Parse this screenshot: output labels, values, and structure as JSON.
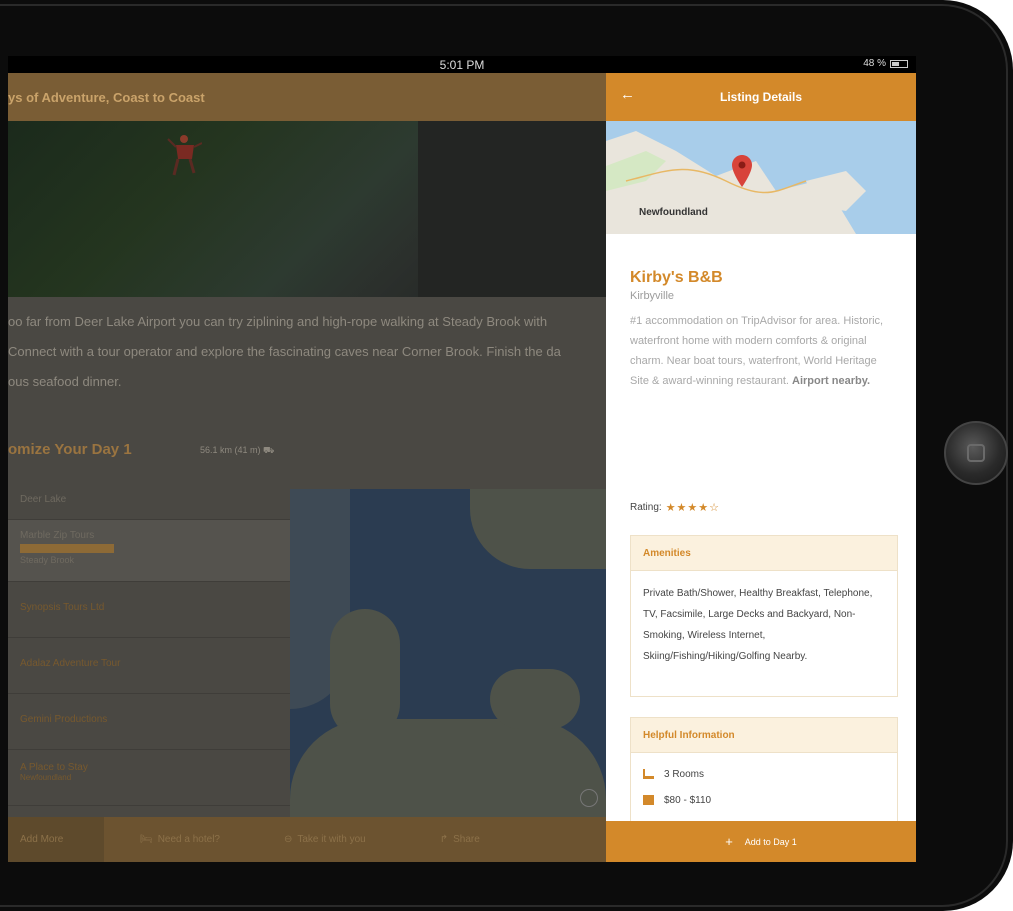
{
  "status_bar": {
    "time": "5:01 PM",
    "battery": "48 %"
  },
  "trip": {
    "title": "ys of Adventure, Coast to Coast",
    "intro_lines": [
      "oo far from Deer Lake Airport you can try ziplining and high-rope walking at Steady Brook with",
      "Connect with a tour operator and explore the fascinating caves near Corner Brook. Finish the da",
      "ous seafood dinner."
    ],
    "customize_title": "omize Your Day 1",
    "distance": "56.1 km (41 m)",
    "list": [
      {
        "label": "Deer Lake"
      },
      {
        "label": "Marble Zip Tours",
        "sub": "Steady Brook"
      },
      {
        "label": "Synopsis Tours Ltd"
      },
      {
        "label": "Adalaz Adventure Tour"
      },
      {
        "label": "Gemini Productions"
      },
      {
        "label": "A Place to Stay",
        "sub": "Newfoundland"
      }
    ],
    "bottom_bar": {
      "add_more": "Add More",
      "need_hotel": "Need a hotel?",
      "take_with_you": "Take it with you",
      "share": "Share"
    }
  },
  "panel": {
    "header_title": "Listing Details",
    "map_label": "Newfoundland",
    "name": "Kirby's B&B",
    "location": "Kirbyville",
    "description": "#1 accommodation on TripAdvisor for area. Historic, waterfront home with modern comforts & original charm. Near boat tours, waterfront, World Heritage Site & award-winning restaurant.",
    "description_strong": "Airport nearby.",
    "rating_label": "Rating:",
    "rating_stars": "★★★★☆",
    "amenities_title": "Amenities",
    "amenities_text": "Private Bath/Shower, Healthy Breakfast, Telephone, TV, Facsimile, Large Decks and Backyard, Non-Smoking, Wireless Internet, Skiing/Fishing/Hiking/Golfing Nearby.",
    "helpful_title": "Helpful Information",
    "rooms": "3 Rooms",
    "price": "$80 - $110",
    "add_button": "Add to Day 1"
  },
  "colors": {
    "accent": "#d3892a",
    "panel_header": "#d3892a",
    "card_header": "#fbf1de"
  }
}
